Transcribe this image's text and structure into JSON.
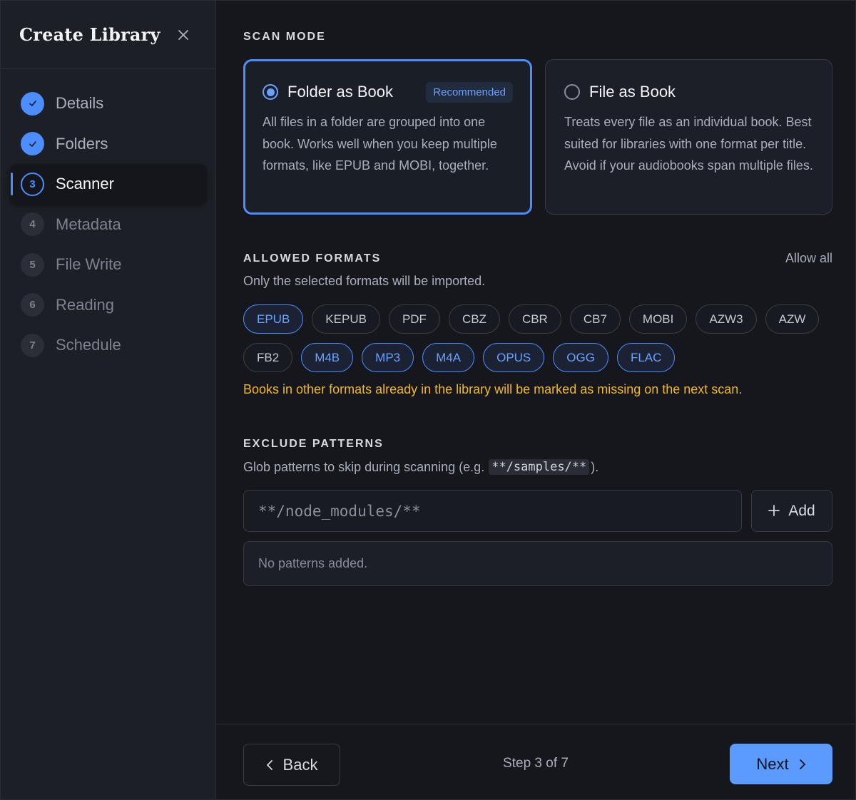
{
  "sidebar": {
    "title": "Create Library",
    "close_icon": "close-icon",
    "steps": [
      {
        "number": "1",
        "label": "Details",
        "state": "done"
      },
      {
        "number": "2",
        "label": "Folders",
        "state": "done"
      },
      {
        "number": "3",
        "label": "Scanner",
        "state": "current"
      },
      {
        "number": "4",
        "label": "Metadata",
        "state": "todo"
      },
      {
        "number": "5",
        "label": "File Write",
        "state": "todo"
      },
      {
        "number": "6",
        "label": "Reading",
        "state": "todo"
      },
      {
        "number": "7",
        "label": "Schedule",
        "state": "todo"
      }
    ]
  },
  "scan_mode": {
    "title": "SCAN MODE",
    "options": [
      {
        "title": "Folder as Book",
        "badge": "Recommended",
        "selected": true,
        "description": "All files in a folder are grouped into one book. Works well when you keep multiple formats, like EPUB and MOBI, together."
      },
      {
        "title": "File as Book",
        "selected": false,
        "description": "Treats every file as an individual book. Best suited for libraries with one format per title. Avoid if your audiobooks span multiple files."
      }
    ]
  },
  "formats": {
    "title": "ALLOWED FORMATS",
    "allow_all": "Allow all",
    "subtitle": "Only the selected formats will be imported.",
    "row1": [
      {
        "label": "EPUB",
        "selected": true
      },
      {
        "label": "KEPUB",
        "selected": false
      },
      {
        "label": "PDF",
        "selected": false
      },
      {
        "label": "CBZ",
        "selected": false
      },
      {
        "label": "CBR",
        "selected": false
      },
      {
        "label": "CB7",
        "selected": false
      },
      {
        "label": "MOBI",
        "selected": false
      },
      {
        "label": "AZW3",
        "selected": false
      },
      {
        "label": "AZW",
        "selected": false
      }
    ],
    "row2": [
      {
        "label": "FB2",
        "selected": false
      },
      {
        "label": "M4B",
        "selected": true
      },
      {
        "label": "MP3",
        "selected": true
      },
      {
        "label": "M4A",
        "selected": true
      },
      {
        "label": "OPUS",
        "selected": true
      },
      {
        "label": "OGG",
        "selected": true
      },
      {
        "label": "FLAC",
        "selected": true
      }
    ],
    "warning": "Books in other formats already in the library will be marked as missing on the next scan."
  },
  "exclude": {
    "title": "EXCLUDE PATTERNS",
    "subtitle_prefix": "Glob patterns to skip during scanning (e.g.",
    "subtitle_code": "**/samples/**",
    "subtitle_suffix": ").",
    "input_placeholder": "**/node_modules/**",
    "add_label": "Add",
    "empty_text": "No patterns added."
  },
  "footer": {
    "back_label": "Back",
    "step_text": "Step 3 of 7",
    "next_label": "Next"
  },
  "colors": {
    "accent": "#4c8dff",
    "warning": "#f1b820",
    "background": "#15171d",
    "sidebar": "#1d1f27"
  }
}
